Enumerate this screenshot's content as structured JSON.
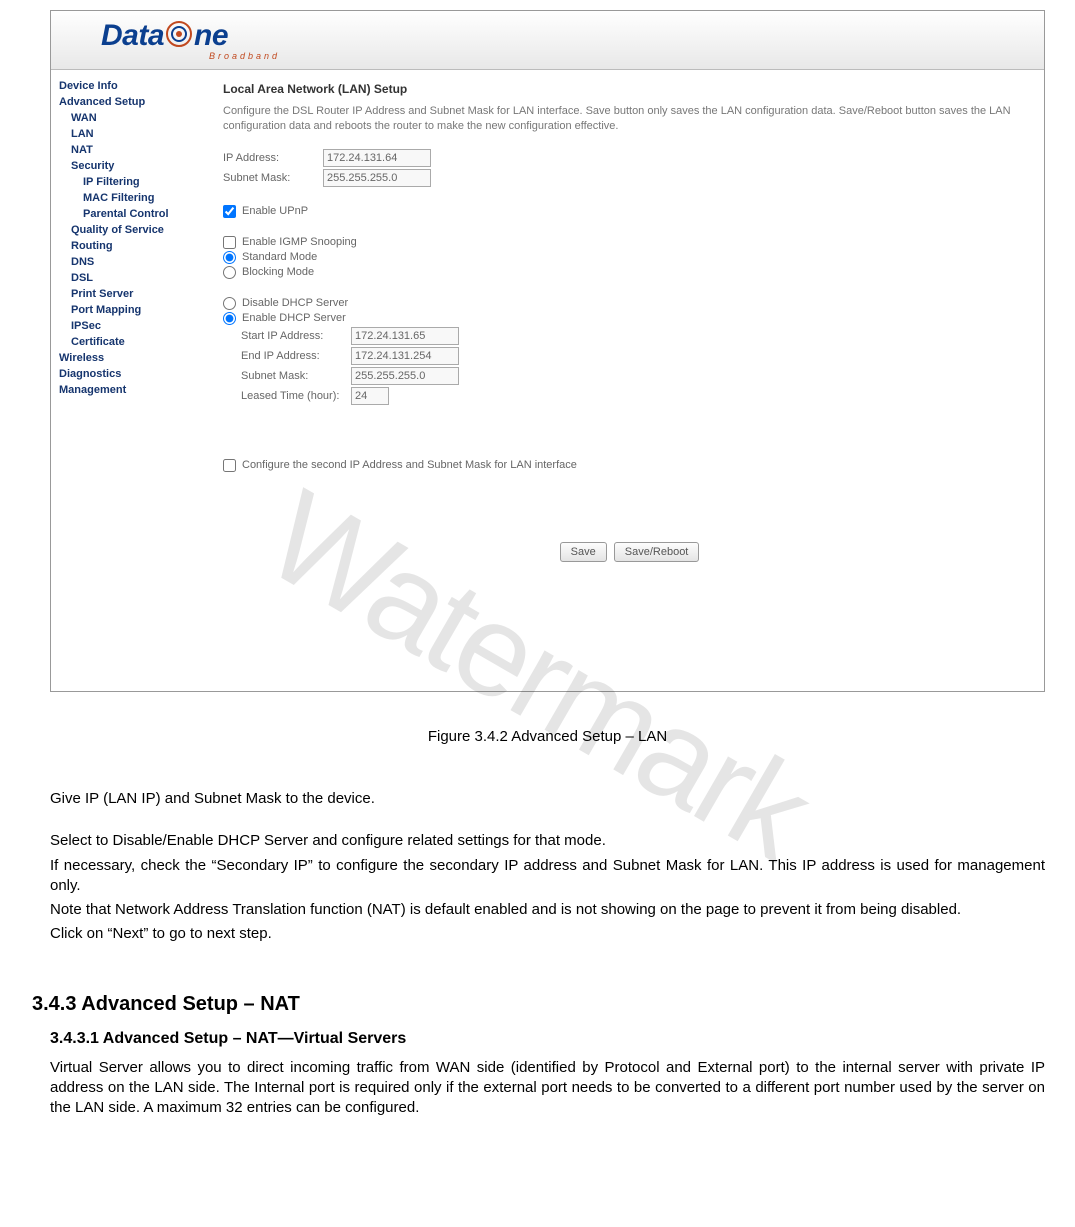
{
  "watermark": "Watermark",
  "banner": {
    "logo_text": "Data",
    "logo_suffix": "ne",
    "tagline": "Broadband"
  },
  "sidebar": {
    "device_info": "Device Info",
    "advanced_setup": "Advanced Setup",
    "wan": "WAN",
    "lan": "LAN",
    "nat": "NAT",
    "security": "Security",
    "ip_filtering": "IP Filtering",
    "mac_filtering": "MAC Filtering",
    "parental_control": "Parental Control",
    "qos": "Quality of Service",
    "routing": "Routing",
    "dns": "DNS",
    "dsl": "DSL",
    "print_server": "Print Server",
    "port_mapping": "Port Mapping",
    "ipsec": "IPSec",
    "certificate": "Certificate",
    "wireless": "Wireless",
    "diagnostics": "Diagnostics",
    "management": "Management"
  },
  "lan_setup": {
    "title": "Local Area Network (LAN) Setup",
    "description": "Configure the DSL Router IP Address and Subnet Mask for LAN interface.  Save button only saves the LAN configuration data.  Save/Reboot button saves the LAN configuration data and reboots the router to make the new configuration effective.",
    "ip_address_label": "IP Address:",
    "ip_address_value": "172.24.131.64",
    "subnet_mask_label": "Subnet Mask:",
    "subnet_mask_value": "255.255.255.0",
    "enable_upnp": "Enable UPnP",
    "enable_igmp": "Enable IGMP Snooping",
    "standard_mode": "Standard Mode",
    "blocking_mode": "Blocking Mode",
    "disable_dhcp": "Disable DHCP Server",
    "enable_dhcp": "Enable DHCP Server",
    "start_ip_label": "Start IP Address:",
    "start_ip_value": "172.24.131.65",
    "end_ip_label": "End IP Address:",
    "end_ip_value": "172.24.131.254",
    "dhcp_subnet_label": "Subnet Mask:",
    "dhcp_subnet_value": "255.255.255.0",
    "leased_time_label": "Leased Time (hour):",
    "leased_time_value": "24",
    "second_ip": "Configure the second IP Address and Subnet Mask for LAN interface",
    "save_btn": "Save",
    "save_reboot_btn": "Save/Reboot"
  },
  "caption": "Figure 3.4.2 Advanced Setup – LAN",
  "body": {
    "p1": "Give IP (LAN IP) and Subnet Mask to the device.",
    "p2": "Select to Disable/Enable DHCP Server and configure related settings for that mode.",
    "p3": "If necessary, check the “Secondary IP” to configure the secondary IP address and Subnet Mask for LAN. This IP address is used for management only.",
    "p4": "Note that Network Address Translation function (NAT) is default enabled and is not showing on the page to prevent it from being disabled.",
    "p5": "Click on “Next” to go to next step."
  },
  "section": {
    "h1": "3.4.3 Advanced Setup – NAT",
    "h2": "3.4.3.1 Advanced Setup – NAT—Virtual Servers",
    "p": "Virtual Server allows you to direct incoming traffic from WAN side (identified by Protocol and External port) to the internal server with private IP address on the LAN side. The Internal port is required only if the external port needs to be converted to a different port number used by the server on the LAN side. A maximum 32 entries can be configured."
  }
}
